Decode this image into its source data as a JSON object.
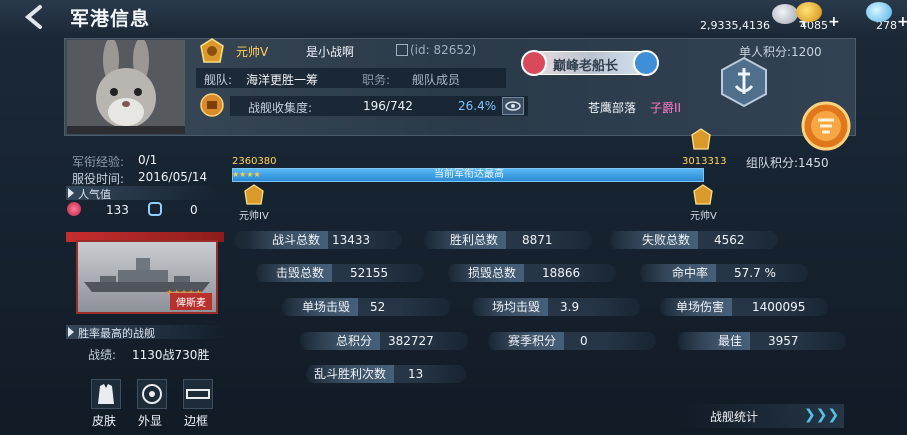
{
  "header": {
    "title": "军港信息"
  },
  "currency": [
    {
      "icon": "silver-coins-icon",
      "value": "2,9335,4136"
    },
    {
      "icon": "gold-coins-icon",
      "value": "4085"
    },
    {
      "icon": "diamond-icon",
      "value": "278"
    }
  ],
  "profile": {
    "rank_title": "元帅V",
    "name": "是小战啊",
    "id_text": "(id: 82652)",
    "fleet_label": "舰队:",
    "fleet_name": "海洋更胜一筹",
    "duty_label": "职务:",
    "duty_value": "舰队成员",
    "collection_label": "战舰收集度:",
    "collection_value": "196/742",
    "collection_percent": "26.4%",
    "badge_text": "巅峰老船长",
    "single_score": "单人积分:1200",
    "tribe_name": "苍鹰部落",
    "tribe_rank": "子爵II",
    "team_score": "组队积分:1450"
  },
  "service": {
    "exp_label": "军衔经验:",
    "exp_value": "0/1",
    "time_label": "服役时间:",
    "time_value": "2016/05/14",
    "popularity_label": "人气值",
    "flowers": "133",
    "slippers": "0"
  },
  "progress": {
    "left_value": "2360380",
    "right_value": "3013313",
    "bar_text": "当前军衔达最高",
    "left_rank": "元帅IV",
    "right_rank": "元帅V",
    "fill": 1.0
  },
  "stats": {
    "battles_label": "战斗总数",
    "battles": "13433",
    "wins_label": "胜利总数",
    "wins": "8871",
    "losses_label": "失败总数",
    "losses": "4562",
    "kills_label": "击毁总数",
    "kills": "52155",
    "lost_label": "损毁总数",
    "lost": "18866",
    "hit_label": "命中率",
    "hit": "57.7 %",
    "maxkill_label": "单场击毁",
    "maxkill": "52",
    "avgkill_label": "场均击毁",
    "avgkill": "3.9",
    "maxdmg_label": "单场伤害",
    "maxdmg": "1400095",
    "total_label": "总积分",
    "total": "382727",
    "season_label": "赛季积分",
    "season": "0",
    "best_label": "最佳",
    "best": "3957",
    "brawl_label": "乱斗胜利次数",
    "brawl": "13"
  },
  "ship": {
    "name": "俾斯麦",
    "section_label": "胜率最高的战舰",
    "record_label": "战绩:",
    "record_value": "1130战730胜"
  },
  "bottom": {
    "skin": "皮肤",
    "appearance": "外显",
    "frame": "边框",
    "fleet_stats": "战舰统计"
  }
}
